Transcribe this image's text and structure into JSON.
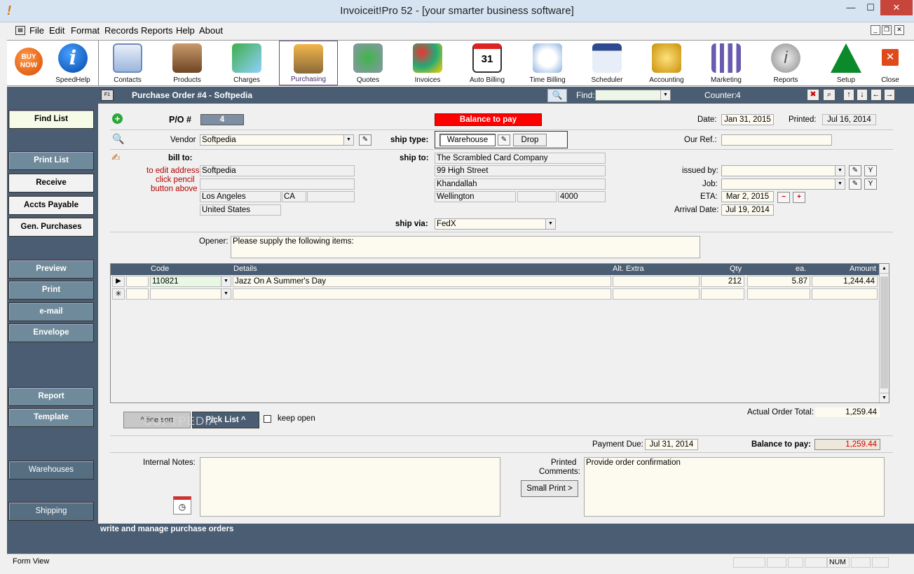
{
  "window": {
    "title": "Invoiceit!Pro 52 - [your smarter business software]",
    "min": "—",
    "max": "☐",
    "close": "✕",
    "mdi_min": "_",
    "mdi_restore": "❐",
    "mdi_close": "✕"
  },
  "menu": [
    "File",
    "Edit",
    "Format",
    "Records",
    "Reports",
    "Help",
    "About"
  ],
  "toolbar": {
    "buy_now": "BUY NOW",
    "speedhelp": "SpeedHelp",
    "items": [
      "Contacts",
      "Products",
      "Charges",
      "Purchasing",
      "Quotes",
      "Invoices",
      "Auto Billing",
      "Time Billing",
      "Scheduler",
      "Accounting",
      "Marketing",
      "Reports",
      "Setup",
      "Close"
    ]
  },
  "header": {
    "badge": "F1",
    "title": "Purchase Order #4 - Softpedia",
    "find_label": "Find:",
    "find_value": "",
    "counter_label": "Counter:",
    "counter_value": "4"
  },
  "sidebar": [
    "Find List",
    "Print List",
    "Receive",
    "Accts Payable",
    "Gen. Purchases",
    "Preview",
    "Print",
    "e-mail",
    "Envelope",
    "Report",
    "Template",
    "Warehouses",
    "Shipping"
  ],
  "po": {
    "label": "P/O #",
    "number": "4",
    "balance_banner": "Balance to pay",
    "date_label": "Date:",
    "date": "Jan 31, 2015",
    "printed_label": "Printed:",
    "printed": "Jul 16, 2014"
  },
  "vendor": {
    "label": "Vendor",
    "value": "Softpedia"
  },
  "ship_type": {
    "label": "ship type:",
    "warehouse": "Warehouse",
    "drop": "Drop"
  },
  "our_ref": {
    "label": "Our Ref.:",
    "value": ""
  },
  "bill_to": {
    "label": "bill to:",
    "hint1": "to edit address",
    "hint2": "click pencil",
    "hint3": "button above",
    "name": "Softpedia",
    "line2": "",
    "city": "Los Angeles",
    "state": "CA",
    "zip": "",
    "country": "United States"
  },
  "ship_to": {
    "label": "ship to:",
    "company": "The Scrambled Card Company",
    "street": "99 High Street",
    "suburb": "Khandallah",
    "city": "Wellington",
    "state": "",
    "zip": "4000"
  },
  "issued_by": {
    "label": "issued by:",
    "value": ""
  },
  "job": {
    "label": "Job:",
    "value": ""
  },
  "eta": {
    "label": "ETA:",
    "value": "Mar 2, 2015"
  },
  "arrival": {
    "label": "Arrival Date:",
    "value": "Jul 19, 2014"
  },
  "ship_via": {
    "label": "ship via:",
    "value": "FedX"
  },
  "opener": {
    "label": "Opener:",
    "value": "Please supply the following items:"
  },
  "grid": {
    "headers": [
      "Code",
      "Details",
      "Alt. Extra",
      "Qty",
      "ea.",
      "Amount"
    ],
    "rows": [
      {
        "code": "110821",
        "details": "Jazz On A Summer's Day",
        "alt": "",
        "qty": "212",
        "ea": "5.87",
        "amount": "1,244.44"
      }
    ]
  },
  "actions": {
    "line_sort": "^ line sort",
    "pick_list": "Pick List ^",
    "keep_open": "keep open"
  },
  "totals": {
    "actual_label": "Actual Order Total:",
    "actual": "1,259.44",
    "payment_due_label": "Payment Due:",
    "payment_due": "Jul 31, 2014",
    "balance_label": "Balance to pay:",
    "balance": "1,259.44"
  },
  "notes": {
    "internal_label": "Internal Notes:",
    "internal": "",
    "printed_label1": "Printed",
    "printed_label2": "Comments:",
    "small_print": "Small Print >",
    "comments": "Provide order confirmation"
  },
  "footer": "write and manage purchase orders",
  "status": {
    "view": "Form View",
    "num": "NUM"
  },
  "watermark": "SOFTPEDIA"
}
